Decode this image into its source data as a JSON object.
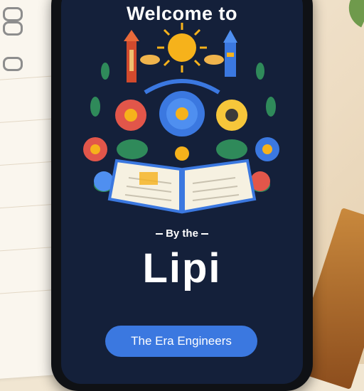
{
  "screen": {
    "title": "Welcome to",
    "by_line": "By the",
    "app_name": "Lipi",
    "cta_button": "The Era Engineers"
  },
  "colors": {
    "screen_bg": "#14203a",
    "button": "#3b78e0",
    "text": "#ffffff",
    "accent_sun": "#f6b21b"
  },
  "icons": [
    "sun-icon",
    "lighthouse-icon",
    "tower-icon",
    "open-book-icon",
    "flower-icon",
    "leaf-icon"
  ]
}
